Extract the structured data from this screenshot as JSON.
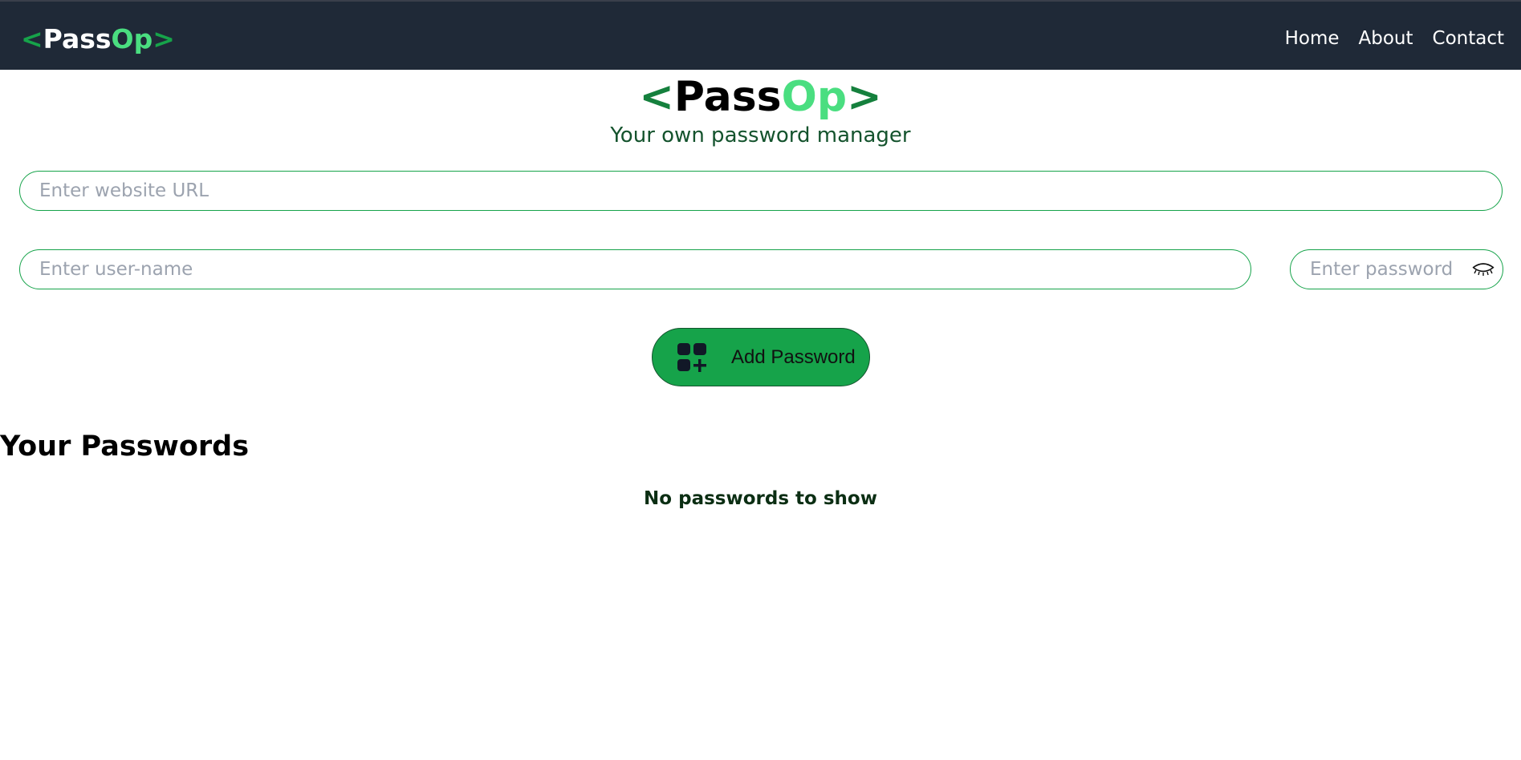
{
  "navbar": {
    "logo": {
      "open": "<",
      "pass": "Pass",
      "op": "Op",
      "close": ">"
    },
    "links": [
      "Home",
      "About",
      "Contact"
    ]
  },
  "hero": {
    "logo": {
      "open": "<",
      "pass": "Pass",
      "op": "Op",
      "close": ">"
    },
    "tagline": "Your own password manager"
  },
  "form": {
    "url_placeholder": "Enter website URL",
    "url_value": "",
    "username_placeholder": "Enter user-name",
    "username_value": "",
    "password_placeholder": "Enter password",
    "password_value": "",
    "password_toggle_icon": "eye-closed-icon",
    "add_button_label": "Add Password",
    "add_button_icon": "grid-add-icon"
  },
  "passwords": {
    "title": "Your Passwords",
    "empty_message": "No passwords to show"
  },
  "colors": {
    "navbar_bg": "#1f2937",
    "accent_green": "#16a34a",
    "light_green": "#4ade80",
    "dark_green": "#14532d"
  }
}
